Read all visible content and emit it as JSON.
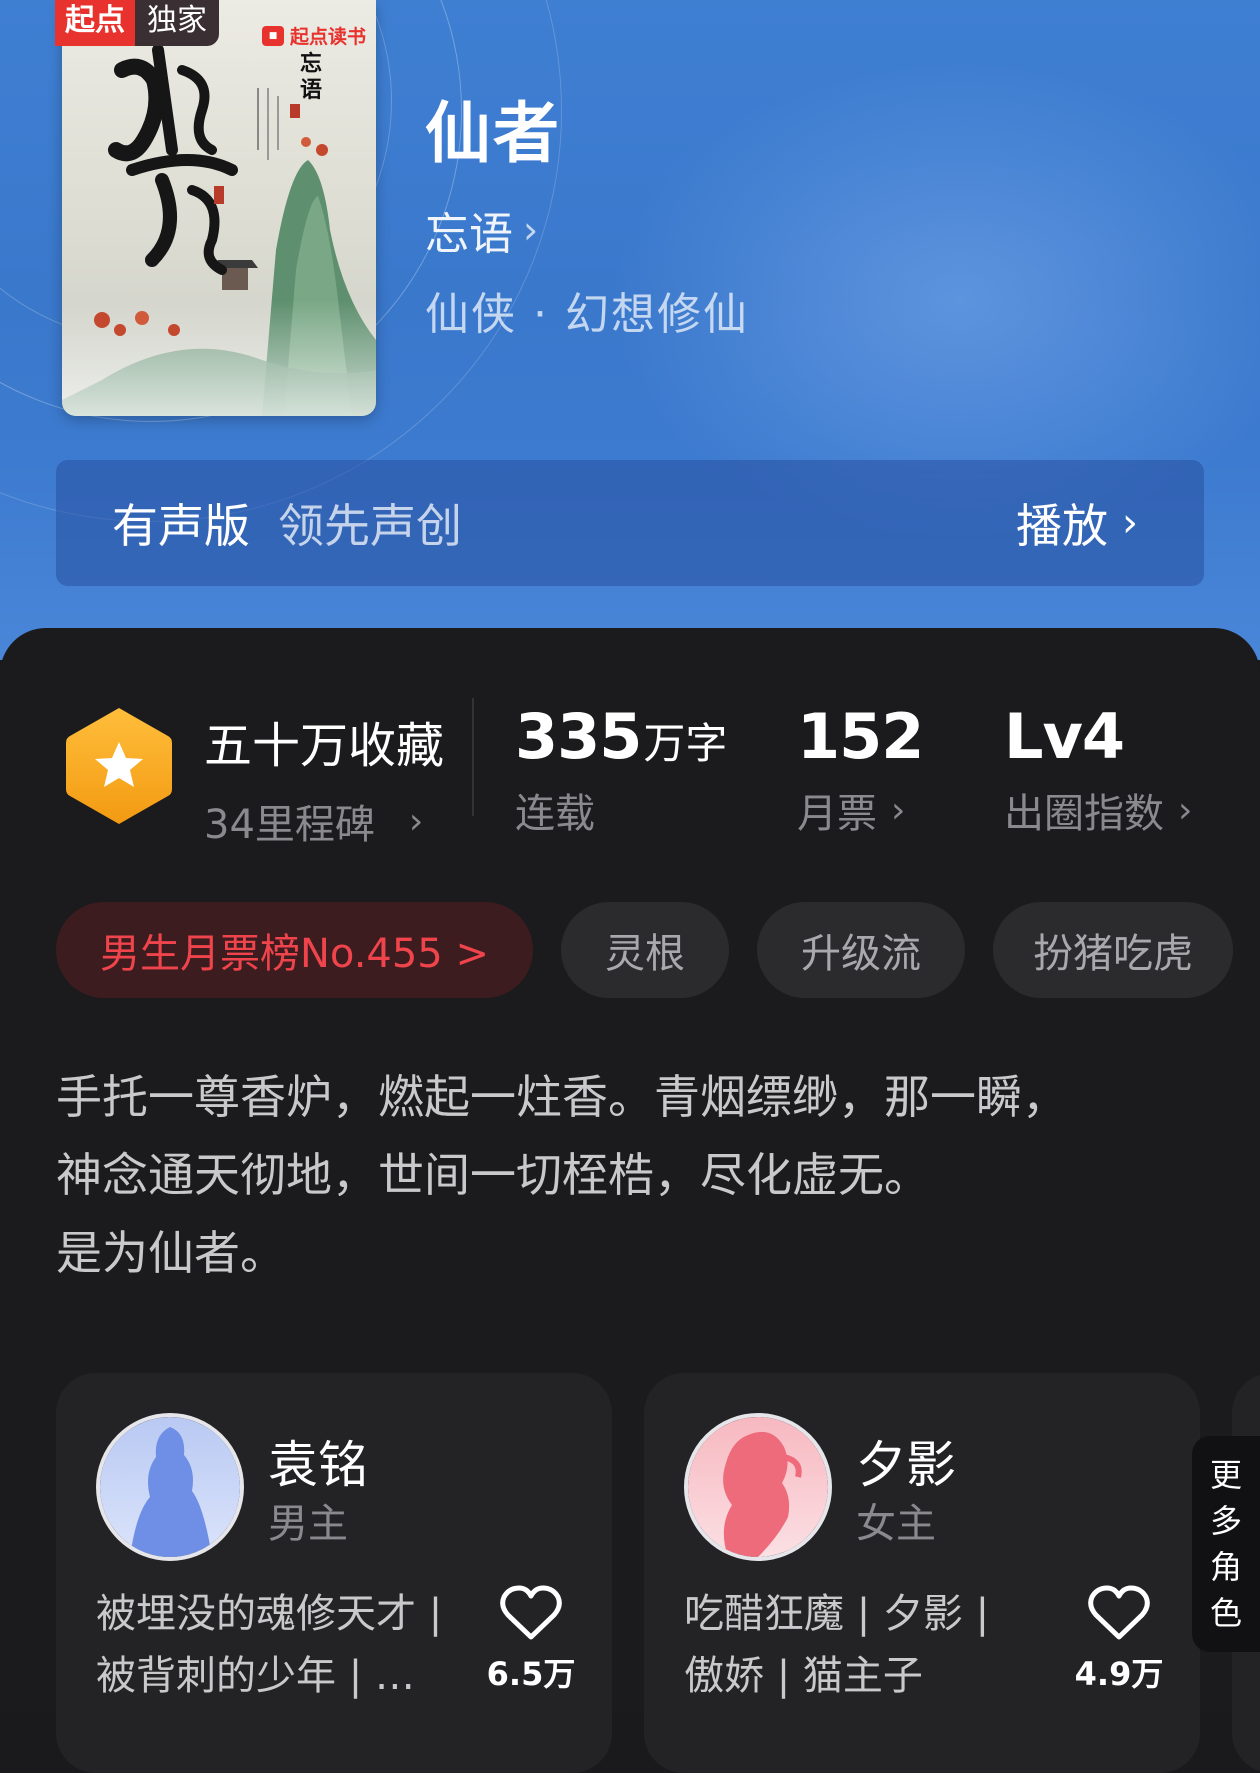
{
  "book": {
    "badge_source": "起点",
    "badge_exclusive": "独家",
    "publisher_logo": "起点读书",
    "cover_title": "仙者",
    "cover_author": "忘语",
    "title": "仙者",
    "author": "忘语",
    "genre": "仙侠 · 幻想修仙"
  },
  "audio": {
    "label": "有声版",
    "subtitle": "领先声创",
    "play": "播放"
  },
  "stats": {
    "collection_title": "五十万收藏",
    "milestones": "34里程碑",
    "words_num": "335",
    "words_unit": "万字",
    "words_label": "连载",
    "monthly_votes": "152",
    "monthly_votes_label": "月票",
    "level": "Lv4",
    "level_label": "出圈指数"
  },
  "tags": {
    "rank": "男生月票榜No.455 >",
    "items": [
      "灵根",
      "升级流",
      "扮猪吃虎"
    ]
  },
  "description": {
    "lines": [
      "手托一尊香炉，燃起一炷香。青烟缥缈，那一瞬，",
      "神念通天彻地，世间一切桎梏，尽化虚无。",
      "是为仙者。"
    ]
  },
  "characters": [
    {
      "name": "袁铭",
      "role": "男主",
      "tags_line1": "被埋没的魂修天才 |",
      "tags_line2": "被背刺的少年 | …",
      "likes": "6.5万",
      "avatar_color": "#6f8fe6"
    },
    {
      "name": "夕影",
      "role": "女主",
      "tags_line1": "吃醋狂魔 | 夕影 |",
      "tags_line2": "傲娇 | 猫主子",
      "likes": "4.9万",
      "avatar_color": "#ee6b7c"
    }
  ],
  "more_characters": [
    "更",
    "多",
    "角",
    "色"
  ],
  "colors": {
    "hero_blue": "#3a78cc",
    "panel_bg": "#1b1b1d",
    "rank_red": "#f0444c",
    "badge_red": "#e8322e",
    "star_orange": "#f5a623"
  },
  "icons": {
    "author_chevron": "chevron-right-icon",
    "play_chevron": "chevron-right-icon",
    "collection": "star-hexagon-icon",
    "like": "heart-outline-icon"
  }
}
